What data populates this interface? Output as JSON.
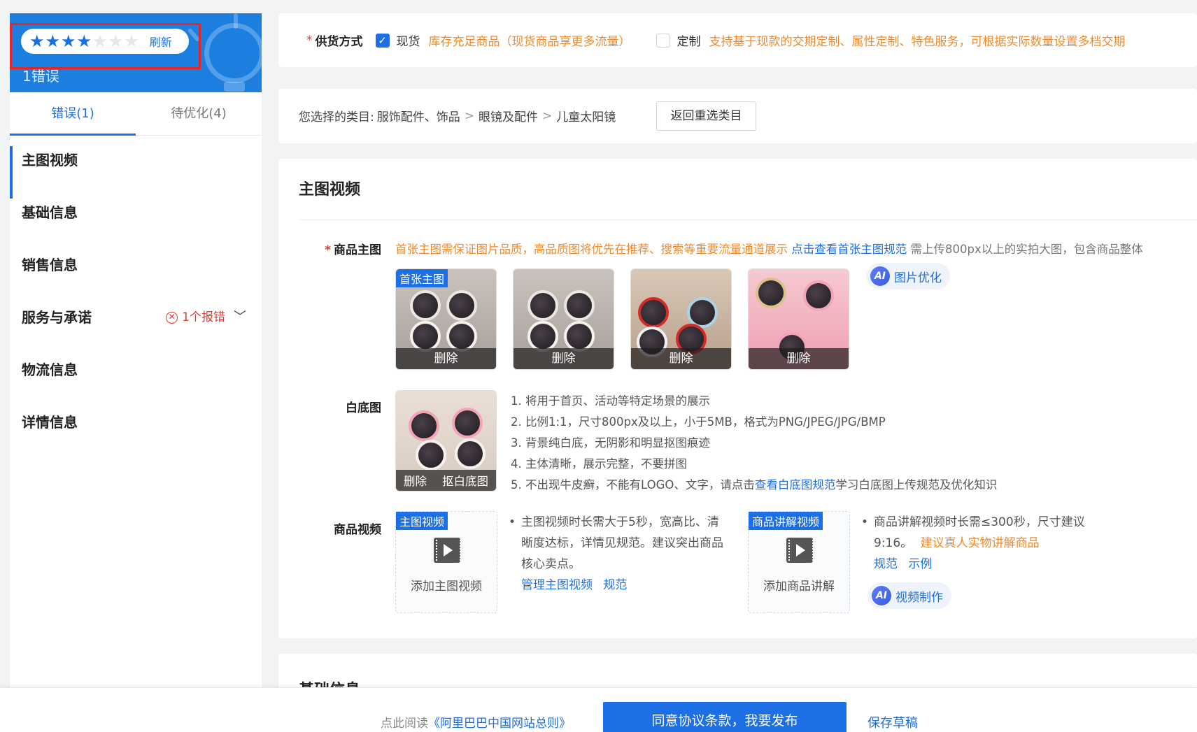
{
  "sidebar": {
    "score": {
      "stars_filled": 4,
      "stars_total": 7,
      "refresh_label": "刷新",
      "subtitle": "1错误"
    },
    "tabs": [
      {
        "label": "错误(1)"
      },
      {
        "label": "待优化(4)"
      }
    ],
    "nav": [
      {
        "label": "主图视频"
      },
      {
        "label": "基础信息"
      },
      {
        "label": "销售信息"
      },
      {
        "label": "服务与承诺",
        "error": "1个报错"
      },
      {
        "label": "物流信息"
      },
      {
        "label": "详情信息"
      }
    ]
  },
  "supply": {
    "label": "供货方式",
    "spot_label": "现货",
    "spot_hint": "库存充足商品（现货商品享更多流量）",
    "custom_label": "定制",
    "custom_hint": "支持基于现款的交期定制、属性定制、特色服务，可根据实际数量设置多档交期"
  },
  "category": {
    "prefix": "您选择的类目:",
    "path": [
      "服饰配件、饰品",
      "眼镜及配件",
      "儿童太阳镜"
    ],
    "reselect_label": "返回重选类目"
  },
  "main_media": {
    "title": "主图视频",
    "main_image": {
      "label": "商品主图",
      "hint_orange": "首张主图需保证图片品质，高品质图将优先在推荐、搜索等重要流量通道展示",
      "hint_link": "点击查看首张主图规范",
      "hint_gray": "需上传800px以上的实拍大图，包含商品整体",
      "first_tag": "首张主图",
      "delete_label": "删除",
      "ai_label": "图片优化"
    },
    "white_bg": {
      "label": "白底图",
      "delete_label": "删除",
      "cutout_label": "抠白底图",
      "rules": [
        "1. 将用于首页、活动等特定场景的展示",
        "2. 比例1:1，尺寸800px及以上，小于5MB，格式为PNG/JPEG/JPG/BMP",
        "3. 背景纯白底，无阴影和明显抠图痕迹",
        "4. 主体清晰，展示完整，不要拼图"
      ],
      "rule5_prefix": "5. 不出现牛皮癣，不能有LOGO、文字，请点击",
      "rule5_link": "查看白底图规范",
      "rule5_suffix": "学习白底图上传规范及优化知识"
    },
    "video": {
      "label": "商品视频",
      "main_tag": "主图视频",
      "main_add": "添加主图视频",
      "main_desc": [
        "主图视频时长需大于5秒，宽高比、清",
        "晰度达标，详情见规范。建议突出商品",
        "核心卖点。"
      ],
      "main_link1": "管理主图视频",
      "main_link2": "规范",
      "explain_tag": "商品讲解视频",
      "explain_add": "添加商品讲解",
      "explain_desc1": "商品讲解视频时长需≤300秒，尺寸建议",
      "explain_desc2": "9:16。",
      "explain_orange": "建议真人实物讲解商品",
      "explain_link1": "规范",
      "explain_link2": "示例",
      "ai_label": "视频制作"
    }
  },
  "next_section_title": "基础信息",
  "footer": {
    "agree_prefix": "点此阅读",
    "agree_link": "《阿里巴巴中国网站总则》",
    "publish_label": "同意协议条款，我要发布",
    "draft_label": "保存草稿"
  }
}
